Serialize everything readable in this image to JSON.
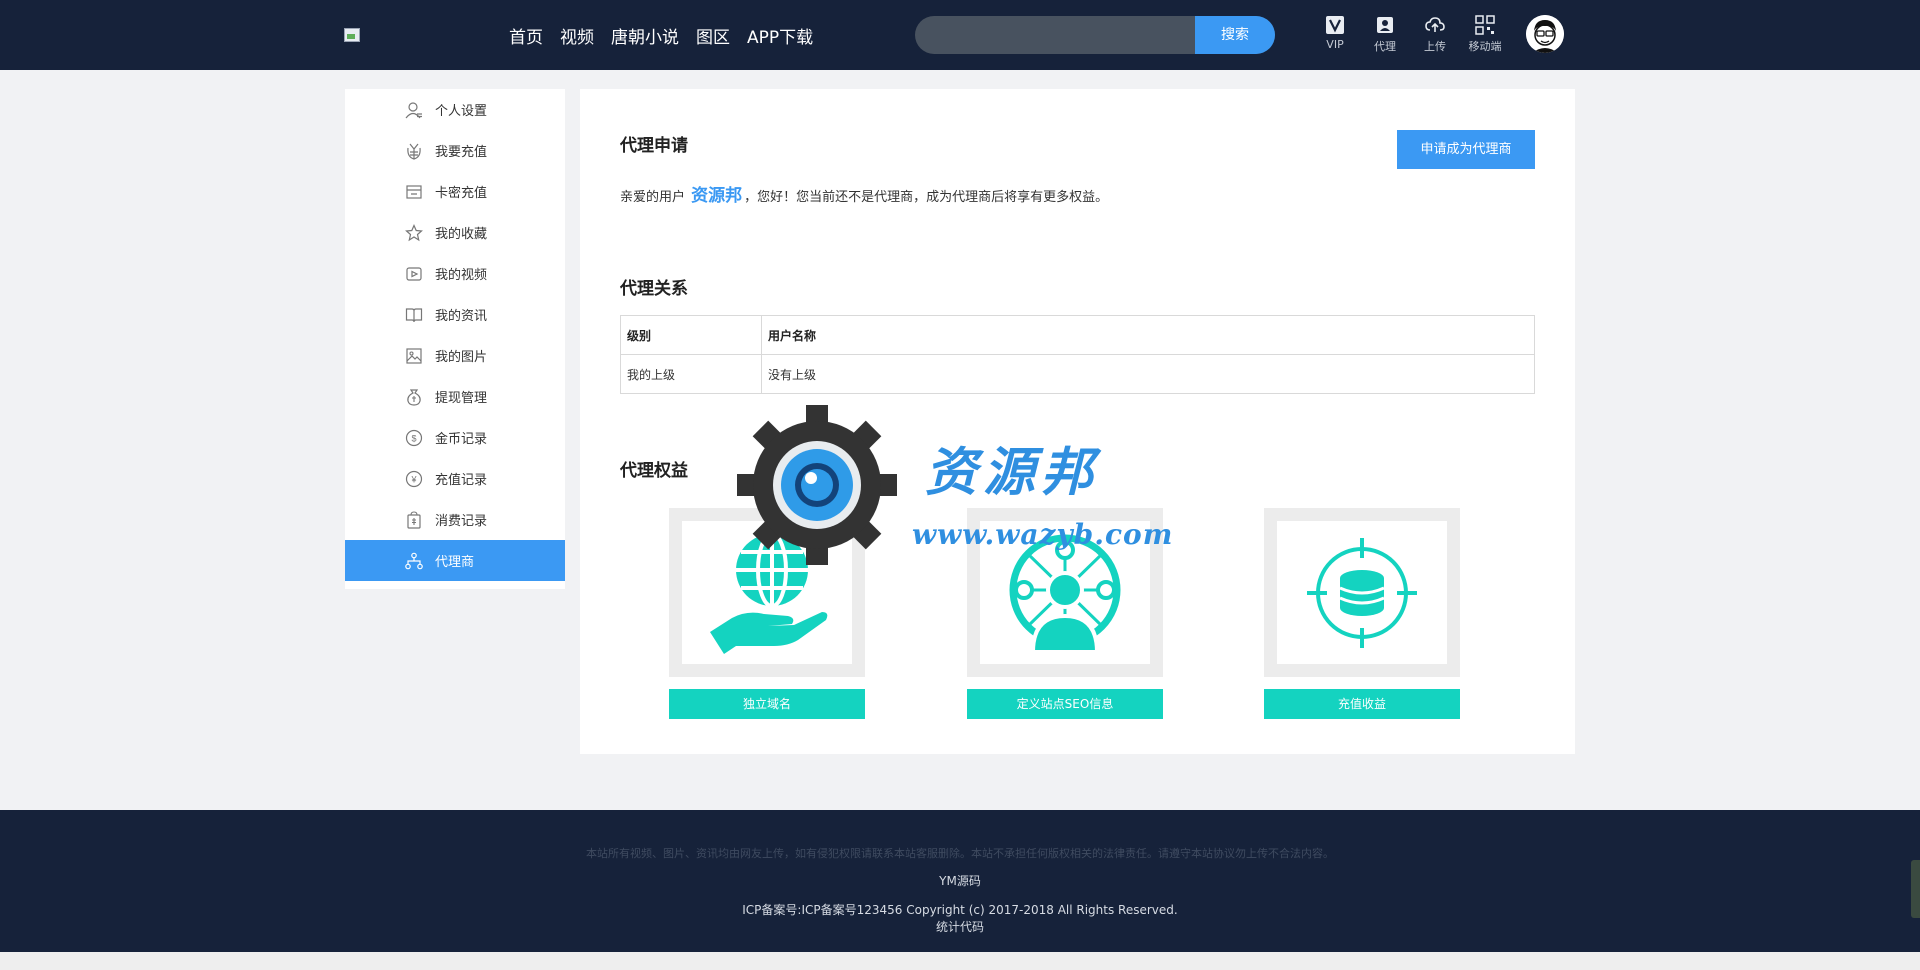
{
  "header": {
    "nav": [
      "首页",
      "视频",
      "唐朝小说",
      "图区",
      "APP下载"
    ],
    "search": {
      "placeholder": "",
      "button": "搜索"
    },
    "tools": [
      {
        "label": "VIP",
        "icon": "vip-icon"
      },
      {
        "label": "代理",
        "icon": "agent-icon"
      },
      {
        "label": "上传",
        "icon": "upload-cloud-icon"
      },
      {
        "label": "移动端",
        "icon": "qrcode-icon"
      }
    ]
  },
  "sidebar": {
    "items": [
      {
        "label": "个人设置",
        "icon": "user-settings-icon"
      },
      {
        "label": "我要充值",
        "icon": "recharge-icon"
      },
      {
        "label": "卡密充值",
        "icon": "card-icon"
      },
      {
        "label": "我的收藏",
        "icon": "star-icon"
      },
      {
        "label": "我的视频",
        "icon": "video-icon"
      },
      {
        "label": "我的资讯",
        "icon": "book-icon"
      },
      {
        "label": "我的图片",
        "icon": "image-icon"
      },
      {
        "label": "提现管理",
        "icon": "withdraw-icon"
      },
      {
        "label": "金币记录",
        "icon": "coin-icon"
      },
      {
        "label": "充值记录",
        "icon": "yuan-icon"
      },
      {
        "label": "消费记录",
        "icon": "bag-icon"
      },
      {
        "label": "代理商",
        "icon": "network-icon",
        "active": true
      }
    ]
  },
  "main": {
    "apply": {
      "title": "代理申请",
      "button": "申请成为代理商",
      "greet_prefix": "亲爱的用户",
      "username": "资源邦",
      "greet_suffix": "，您好！您当前还不是代理商，成为代理商后将享有更多权益。"
    },
    "relation": {
      "title": "代理关系",
      "headers": [
        "级别",
        "用户名称"
      ],
      "rows": [
        [
          "我的上级",
          "没有上级"
        ]
      ]
    },
    "benefits": {
      "title": "代理权益",
      "items": [
        {
          "label": "独立域名",
          "icon": "globe-hand-icon"
        },
        {
          "label": "定义站点SEO信息",
          "icon": "user-network-icon"
        },
        {
          "label": "充值收益",
          "icon": "coins-target-icon"
        }
      ]
    }
  },
  "watermark": {
    "name": "资源邦",
    "url": "www.wazyb.com"
  },
  "footer": {
    "note": "本站所有视频、图片、资讯均由网友上传，如有侵犯权限请联系本站客服删除。本站不承担任何版权相关的法律责任。请遵守本站协议勿上传不合法内容。",
    "brand": "YM源码",
    "copyright": "ICP备案号:ICP备案号123456   Copyright (c) 2017-2018 All Rights Reserved.",
    "stats": "统计代码"
  },
  "colors": {
    "header_bg": "#16223a",
    "accent": "#3b99f3",
    "teal": "#14d3c0",
    "page_bg": "#f1f2f4"
  }
}
